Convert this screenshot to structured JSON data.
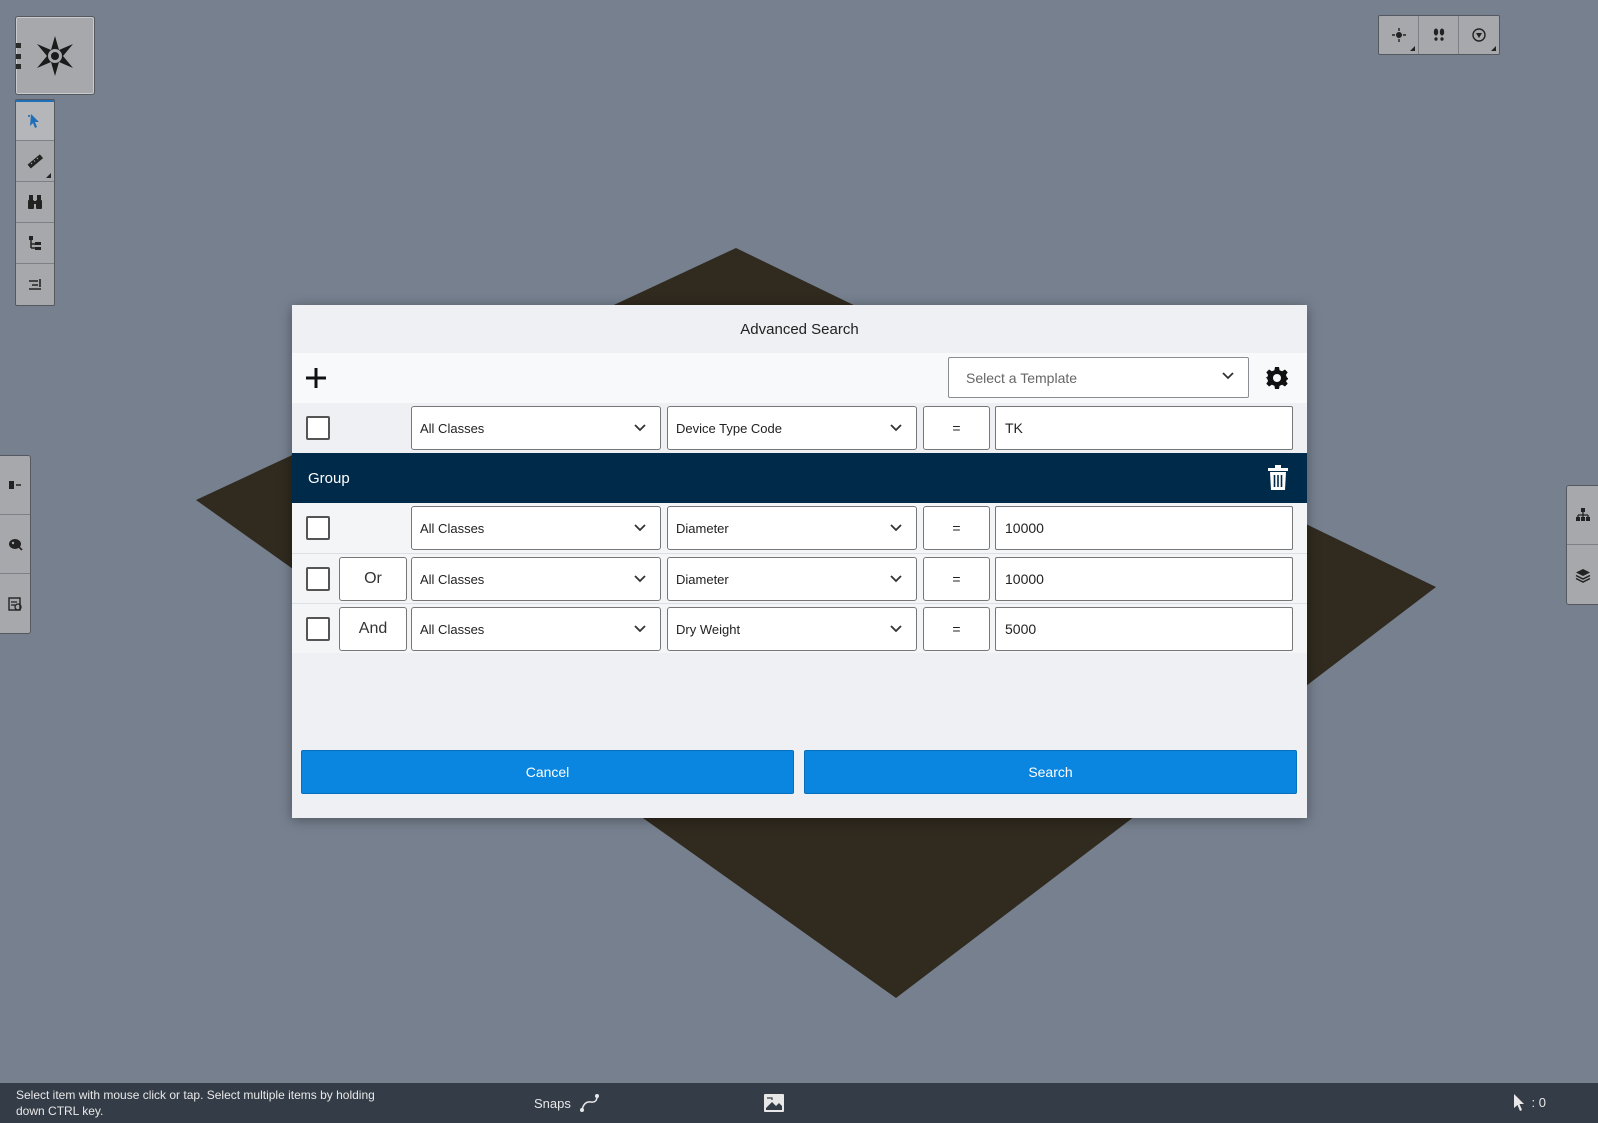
{
  "dialog": {
    "title": "Advanced Search",
    "template_placeholder": "Select a Template",
    "rows": [
      {
        "logic": "",
        "class": "All Classes",
        "property": "Device Type Code",
        "operator": "=",
        "value": "TK"
      }
    ],
    "group": {
      "label": "Group",
      "rows": [
        {
          "logic": "",
          "class": "All Classes",
          "property": "Diameter",
          "operator": "=",
          "value": "10000"
        },
        {
          "logic": "Or",
          "class": "All Classes",
          "property": "Diameter",
          "operator": "=",
          "value": "10000"
        },
        {
          "logic": "And",
          "class": "All Classes",
          "property": "Dry Weight",
          "operator": "=",
          "value": "5000"
        }
      ]
    },
    "cancel_label": "Cancel",
    "search_label": "Search"
  },
  "status_bar": {
    "message": "Select item with mouse click or tap. Select multiple items by holding down CTRL key.",
    "snaps_label": "Snaps",
    "selection_count": ": 0"
  },
  "icons": {
    "logo": "compass-logo-icon",
    "tools": [
      "select-pointer-icon",
      "measure-ruler-icon",
      "binoculars-icon",
      "hierarchy-filter-icon",
      "list-indent-icon"
    ],
    "left_tabs": [
      "panel-toggle-icon",
      "palette-icon",
      "properties-icon"
    ],
    "right_tabs": [
      "tree-hierarchy-icon",
      "layers-icon"
    ],
    "top_right": [
      "pan-crosshair-icon",
      "walk-footprints-icon",
      "orbit-icon"
    ]
  },
  "colors": {
    "background": "#76808f",
    "ground": "#302a1f",
    "group_header": "#002a4a",
    "primary_button": "#0a86e0",
    "active_tool": "#1f6fb8",
    "status_bar": "#343c47"
  }
}
